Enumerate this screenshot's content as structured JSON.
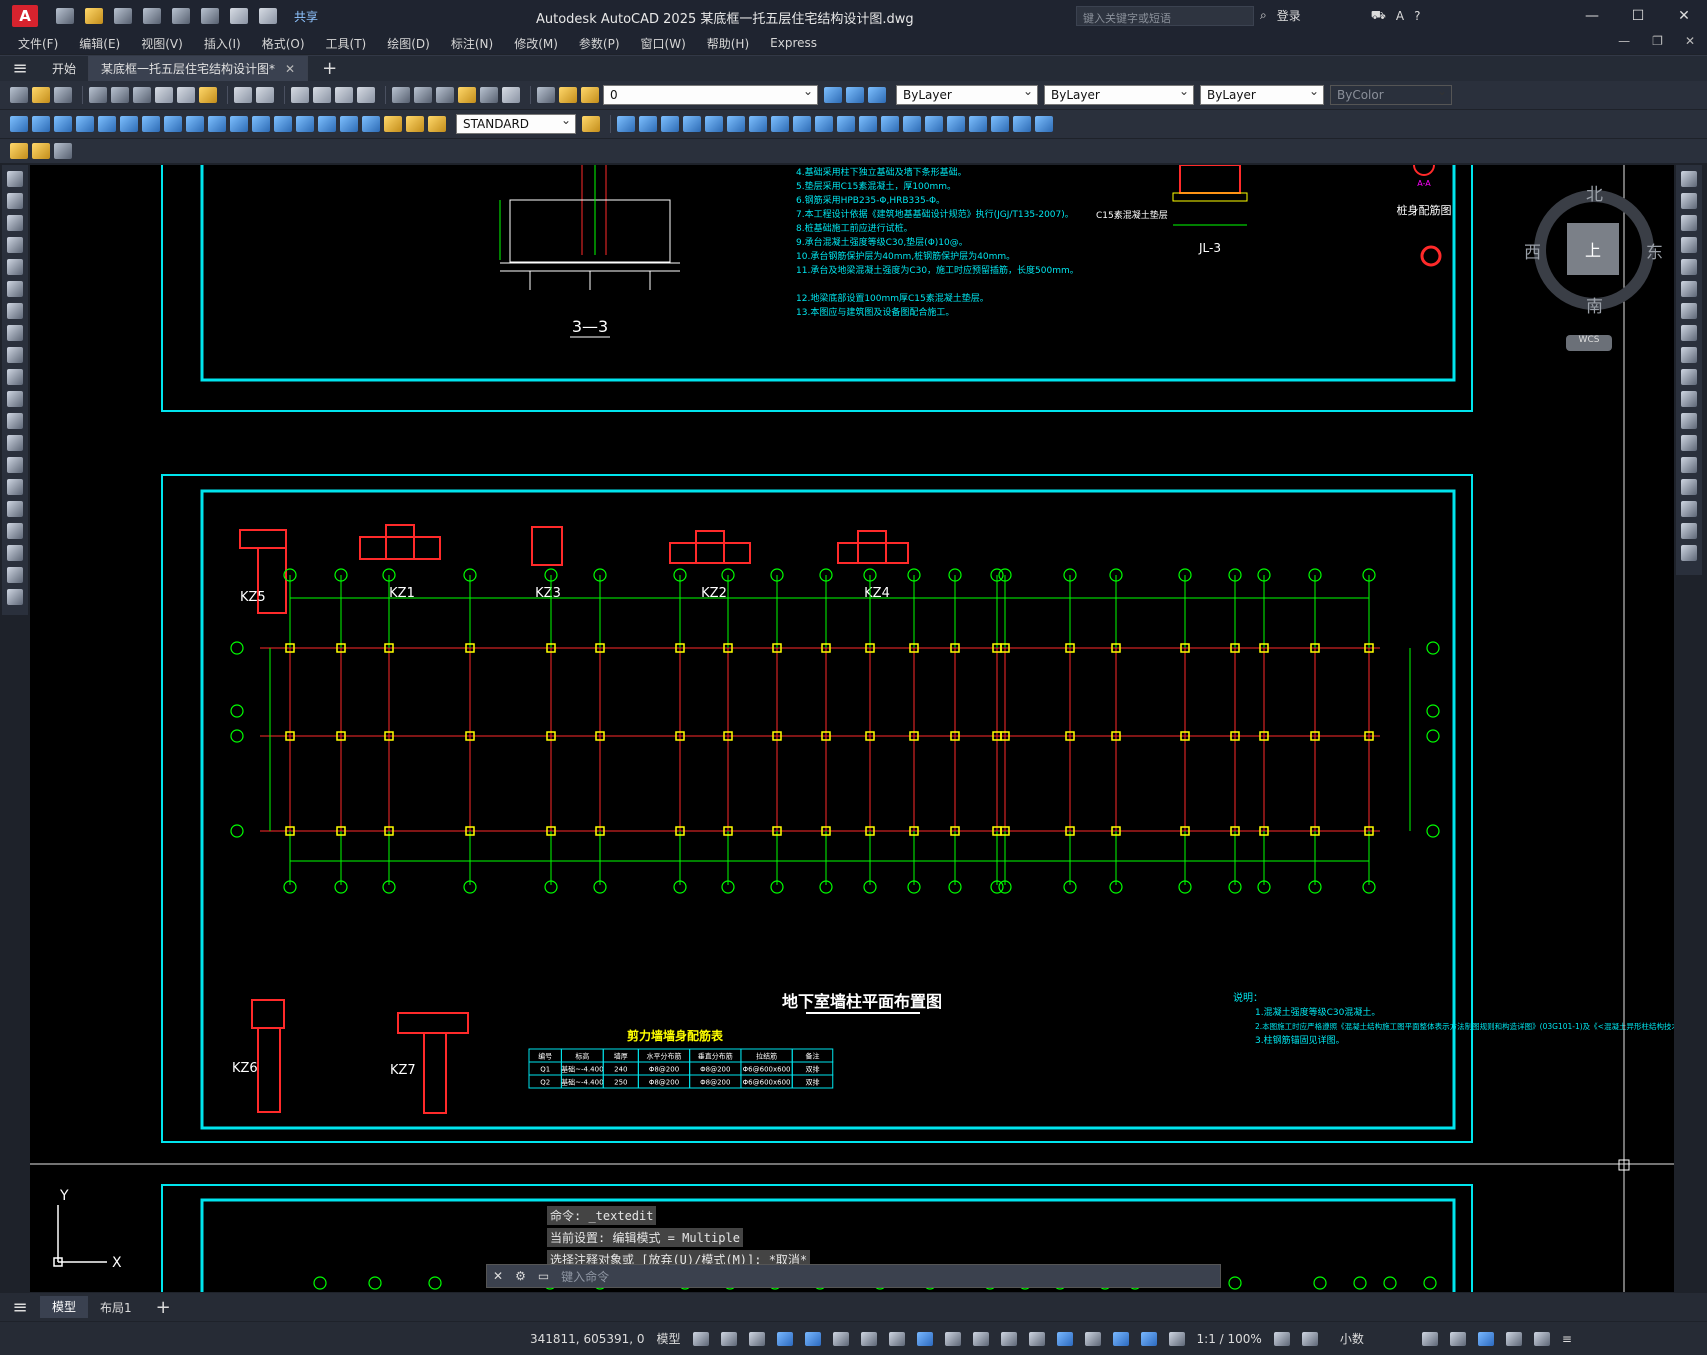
{
  "window": {
    "title": "Autodesk AutoCAD 2025    某底框一托五层住宅结构设计图.dwg",
    "share": "共享",
    "search_placeholder": "键入关键字或短语",
    "login": "登录"
  },
  "menu": [
    "文件(F)",
    "编辑(E)",
    "视图(V)",
    "插入(I)",
    "格式(O)",
    "工具(T)",
    "绘图(D)",
    "标注(N)",
    "修改(M)",
    "参数(P)",
    "窗口(W)",
    "帮助(H)",
    "Express"
  ],
  "tabs": {
    "start": "开始",
    "doc": "某底框一托五层住宅结构设计图*"
  },
  "properties": {
    "layer": "0",
    "text_style": "STANDARD",
    "color": "ByLayer",
    "linetype": "ByLayer",
    "lineweight": "ByLayer",
    "plotstyle": "ByColor"
  },
  "navcube": {
    "north": "北",
    "south": "南",
    "east": "东",
    "west": "西",
    "face": "上",
    "wcs": "WCS"
  },
  "drawing": {
    "section_label": "3—3",
    "jl_label": "JL-3",
    "c15_label": "C15素混凝土垫层",
    "pile_label": "桩身配筋图",
    "aa_label": "A-A",
    "plan_title": "地下室墙柱平面布置图",
    "wall_table_title": "剪力墙墙身配筋表",
    "wall_table_headers": [
      "编号",
      "标高",
      "墙厚",
      "水平分布筋",
      "垂直分布筋",
      "拉结筋",
      "备注"
    ],
    "wall_table_rows": [
      [
        "Q1",
        "基础~-4.400",
        "240",
        "Φ8@200",
        "Φ8@200",
        "Φ6@600x600",
        "双排"
      ],
      [
        "Q2",
        "基础~-4.400",
        "250",
        "Φ8@200",
        "Φ8@200",
        "Φ6@600x600",
        "双排"
      ]
    ],
    "columns": [
      "KZ5",
      "KZ1",
      "KZ3",
      "KZ2",
      "KZ4",
      "KZ6",
      "KZ7"
    ],
    "notes_title": "说明：",
    "notes": [
      "1.混凝土强度等级C30混凝土。",
      "2.本图施工时应严格遵照《混凝土结构施工图平面整体表示方法制图规则和构造详图》(03G101-1)及《<混凝土异形柱结构技术规程>>JGJ149-2006要求进行施工。",
      "3.柱钢筋锚固见详图。"
    ],
    "general_notes": [
      "4.基础采用柱下独立基础及墙下条形基础。",
      "5.垫层采用C15素混凝土，厚100mm。",
      "6.钢筋采用HPB235-Φ,HRB335-Φ。",
      "7.本工程设计依据《建筑地基基础设计规范》执行(JGJ/T135-2007)。",
      "8.桩基础施工前应进行试桩。",
      "9.承台混凝土强度等级C30,垫层(Φ)10@。",
      "10.承台钢筋保护层为40mm,桩钢筋保护层为40mm。",
      "11.承台及地梁混凝土强度为C30，施工时应预留插筋，长度500mm。",
      "12.地梁底部设置100mm厚C15素混凝土垫层。",
      "13.本图应与建筑图及设备图配合施工。"
    ]
  },
  "command": {
    "history": [
      "命令:  _textedit",
      "当前设置: 编辑模式 = Multiple",
      "选择注释对象或 [放弃(U)/模式(M)]: *取消*"
    ],
    "placeholder": "键入命令"
  },
  "layouts": [
    "模型",
    "布局1"
  ],
  "status": {
    "coords": "341811, 605391, 0",
    "model": "模型",
    "scale": "1:1 / 100%",
    "units": "小数"
  },
  "colors": {
    "accent": "#00e5ee",
    "grid": "#00ff00",
    "red": "#ff2a2a",
    "yellow": "#ffff00"
  }
}
